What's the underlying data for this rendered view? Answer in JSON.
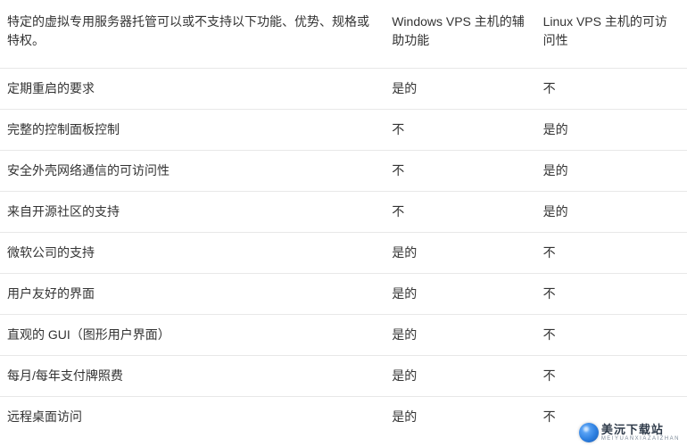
{
  "chart_data": {
    "type": "table",
    "headers": {
      "feature": "特定的虚拟专用服务器托管可以或不支持以下功能、优势、规格或特权。",
      "windows": "Windows VPS 主机的辅助功能",
      "linux": "Linux VPS 主机的可访问性"
    },
    "rows": [
      {
        "feature": "定期重启的要求",
        "windows": "是的",
        "linux": "不"
      },
      {
        "feature": "完整的控制面板控制",
        "windows": "不",
        "linux": "是的"
      },
      {
        "feature": "安全外壳网络通信的可访问性",
        "windows": "不",
        "linux": "是的"
      },
      {
        "feature": "来自开源社区的支持",
        "windows": "不",
        "linux": "是的"
      },
      {
        "feature": "微软公司的支持",
        "windows": "是的",
        "linux": "不"
      },
      {
        "feature": "用户友好的界面",
        "windows": "是的",
        "linux": "不"
      },
      {
        "feature": "直观的 GUI（图形用户界面）",
        "windows": "是的",
        "linux": "不"
      },
      {
        "feature": "每月/每年支付牌照费",
        "windows": "是的",
        "linux": "不"
      },
      {
        "feature": "远程桌面访问",
        "windows": "是的",
        "linux": "不"
      }
    ]
  },
  "watermark": {
    "main": "美沅下载站",
    "sub": "MEIYUANXIAZAIZHAN"
  }
}
